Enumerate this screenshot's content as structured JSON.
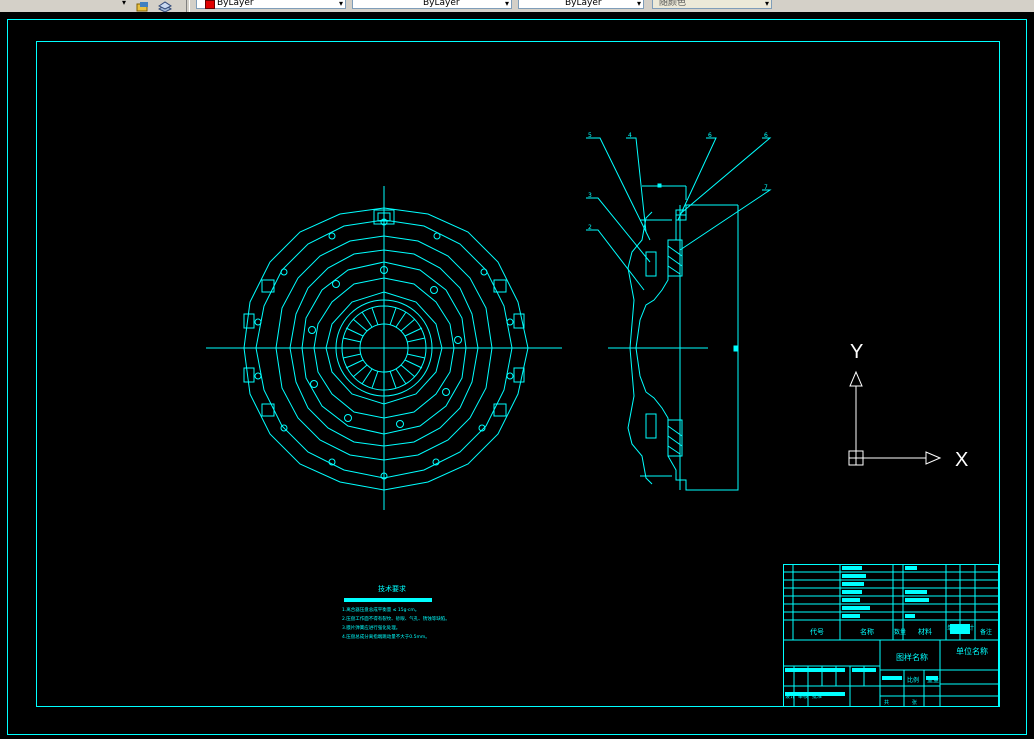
{
  "toolbar": {
    "linetype_1": "ByLayer",
    "linetype_2": "ByLayer",
    "lineweight": "ByLayer",
    "plotstyle": "随颜色",
    "swatch_color": "#e00000"
  },
  "drawing": {
    "line_color": "#00ffff",
    "background": "#000000",
    "ucs_x": "X",
    "ucs_y": "Y",
    "notes_title": "技术要求",
    "notes": [
      "1.离合器压盘总成平衡量 ≤ 15g·cm。",
      "2.压盘工作面不得有裂纹、砂眼、气孔、锈蚀等缺陷。",
      "3.膜片弹簧应进行强化处理。",
      "4.压盘总成分离指端跳动量不大于0.5mm。"
    ],
    "balloons": [
      "5",
      "4",
      "6",
      "6",
      "3",
      "2",
      "7"
    ],
    "titleblock": {
      "col_code": "代号",
      "col_name": "名称",
      "col_qty": "数量",
      "col_material": "材料",
      "col_weight": "单件",
      "col_total": "总计",
      "col_remark": "备注",
      "drawing_name": "图样名称",
      "unit_name": "单位名称",
      "scale": "比例",
      "weight": "重量",
      "sheet": "共",
      "sheet2": "张",
      "design": "设计",
      "check": "审核",
      "approve": "批准"
    }
  }
}
